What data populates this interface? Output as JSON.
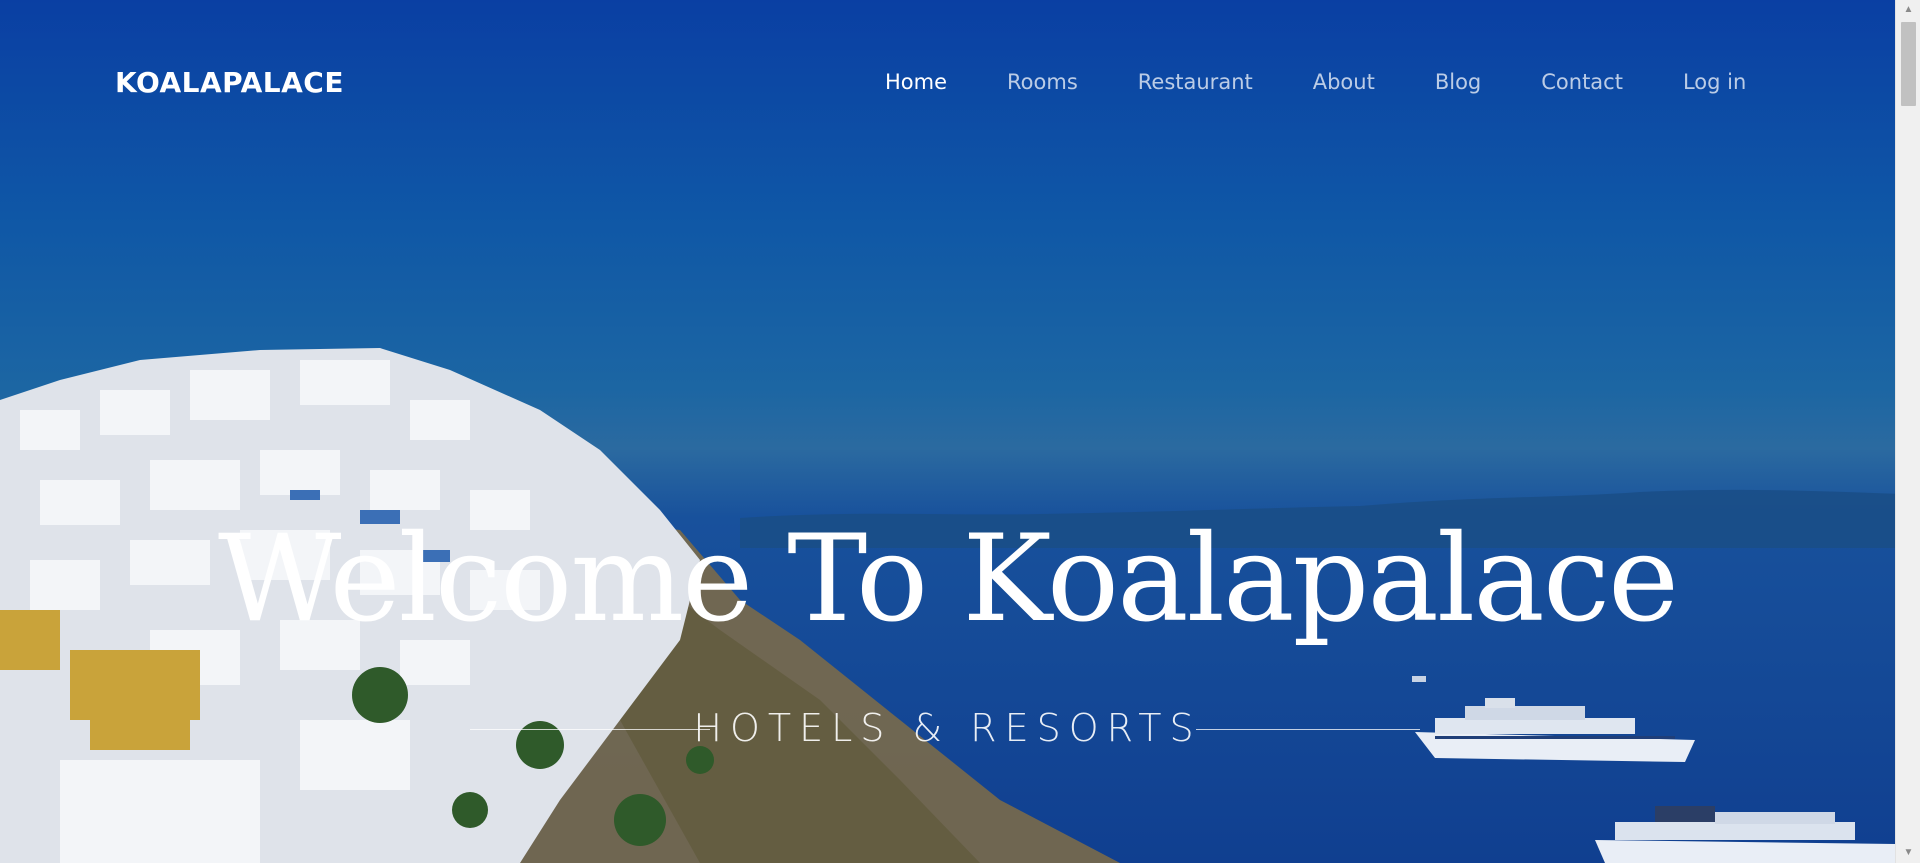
{
  "brand": {
    "logo": "KOALAPALACE"
  },
  "nav": {
    "items": [
      {
        "label": "Home",
        "active": true
      },
      {
        "label": "Rooms",
        "active": false
      },
      {
        "label": "Restaurant",
        "active": false
      },
      {
        "label": "About",
        "active": false
      },
      {
        "label": "Blog",
        "active": false
      },
      {
        "label": "Contact",
        "active": false
      },
      {
        "label": "Log in",
        "active": false
      }
    ]
  },
  "hero": {
    "title": "Welcome To Koalapalace",
    "subtitle": "HOTELS & RESORTS",
    "colors": {
      "sky": "#0a3fa3",
      "sea": "#103f90",
      "text": "#ffffff"
    }
  },
  "scrollbar": {
    "up_icon": "triangle-up",
    "down_icon": "triangle-down"
  }
}
